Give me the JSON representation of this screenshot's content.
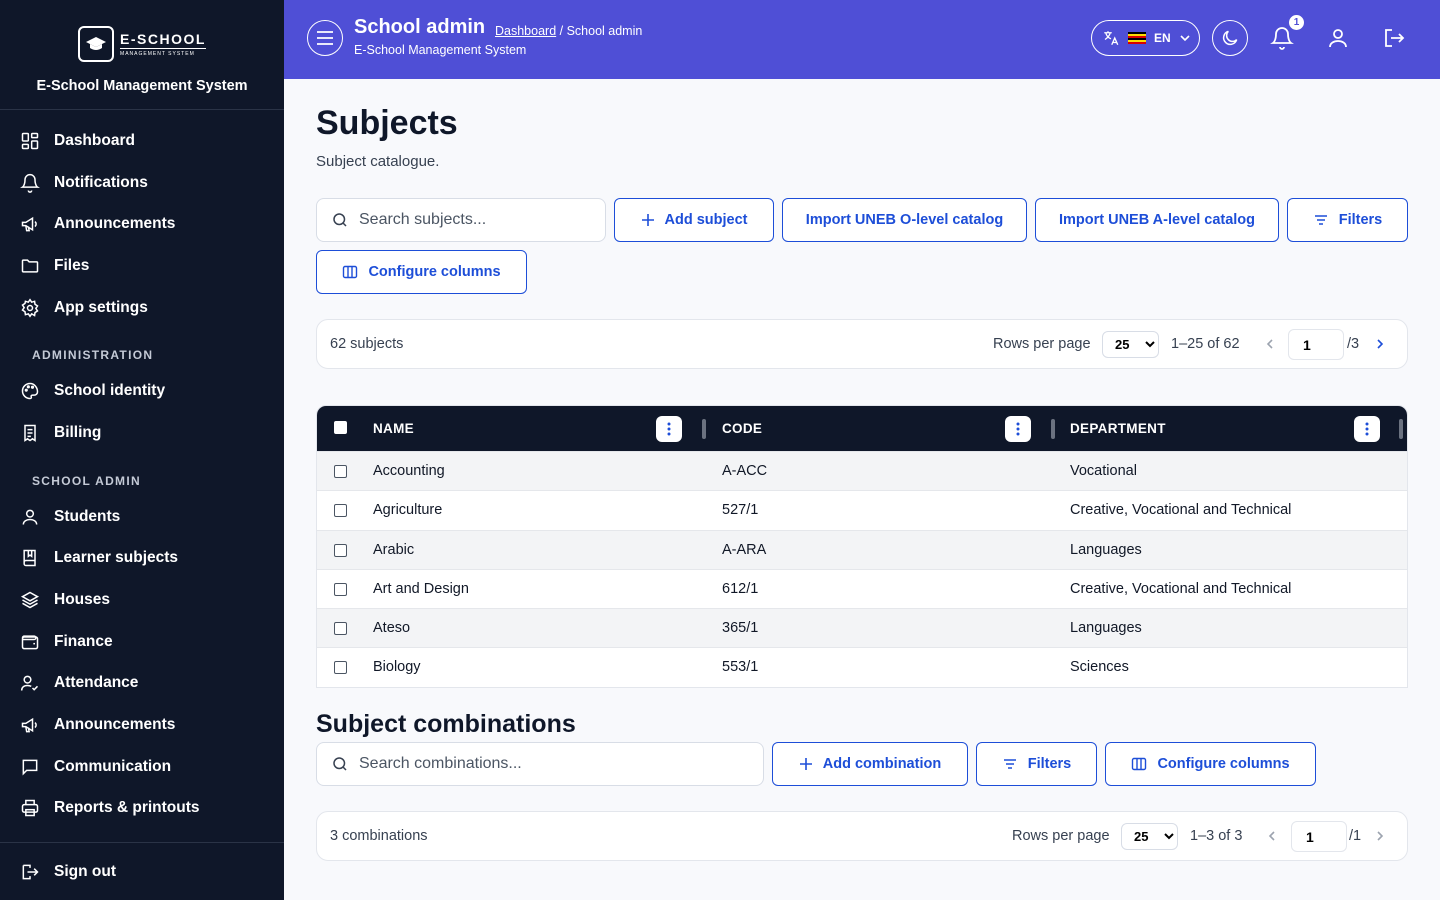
{
  "sidebar": {
    "logo_big": "E-SCHOOL",
    "logo_small": "MANAGEMENT SYSTEM",
    "app_name": "E-School Management System",
    "items_top": [
      "Dashboard",
      "Notifications",
      "Announcements",
      "Files",
      "App settings"
    ],
    "section_admin": "ADMINISTRATION",
    "items_admin": [
      "School identity",
      "Billing"
    ],
    "section_school": "SCHOOL ADMIN",
    "items_school": [
      "Students",
      "Learner subjects",
      "Houses",
      "Finance",
      "Attendance",
      "Announcements",
      "Communication",
      "Reports & printouts"
    ],
    "signout": "Sign out"
  },
  "header": {
    "title": "School admin",
    "crumb_link": "Dashboard",
    "crumb_rest": " / School admin",
    "subtitle": "E-School Management System",
    "lang": "EN",
    "notif_count": "1",
    "accent": "#4f4fd6"
  },
  "main": {
    "title": "Subjects",
    "subtitle": "Subject catalogue.",
    "search_placeholder": "Search subjects...",
    "add_label": "Add subject",
    "import_o": "Import UNEB O-level catalog",
    "import_a": "Import UNEB A-level catalog",
    "filters": "Filters",
    "configure": "Configure columns",
    "pager": {
      "count": "62 subjects",
      "rpp_label": "Rows per page",
      "rpp": "25",
      "range": "1–25 of 62",
      "page": "1",
      "total": "/3"
    },
    "columns": [
      "NAME",
      "CODE",
      "DEPARTMENT"
    ],
    "rows": [
      [
        "Accounting",
        "A-ACC",
        "Vocational"
      ],
      [
        "Agriculture",
        "527/1",
        "Creative, Vocational and Technical"
      ],
      [
        "Arabic",
        "A-ARA",
        "Languages"
      ],
      [
        "Art and Design",
        "612/1",
        "Creative, Vocational and Technical"
      ],
      [
        "Ateso",
        "365/1",
        "Languages"
      ],
      [
        "Biology",
        "553/1",
        "Sciences"
      ]
    ]
  },
  "combos": {
    "title": "Subject combinations",
    "search_placeholder": "Search combinations...",
    "add_label": "Add combination",
    "filters": "Filters",
    "configure": "Configure columns",
    "pager": {
      "count": "3 combinations",
      "rpp_label": "Rows per page",
      "rpp": "25",
      "range": "1–3 of 3",
      "page": "1",
      "total": "/1"
    }
  }
}
